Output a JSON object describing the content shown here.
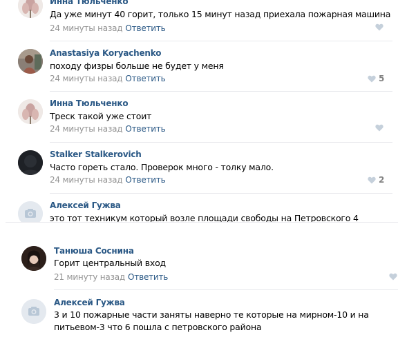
{
  "comments_top": [
    {
      "author": "Инна Тюльченко",
      "text": "Да уже минут 40 горит, только 15 минут назад приехала пожарная машина",
      "time": "24 минуты назад",
      "reply_label": "Ответить",
      "likes": ""
    },
    {
      "author": "Anastasiya Koryachenko",
      "text": "походу физры больше не будет у меня",
      "time": "24 минуты назад",
      "reply_label": "Ответить",
      "likes": "5"
    },
    {
      "author": "Инна Тюльченко",
      "text": "Треск такой уже стоит",
      "time": "24 минуты назад",
      "reply_label": "Ответить",
      "likes": ""
    },
    {
      "author": "Stalker Stalkerovich",
      "text": "Часто гореть стало. Проверок много - толку мало.",
      "time": "24 минуты назад",
      "reply_label": "Ответить",
      "likes": "2"
    },
    {
      "author": "Алексей Гужва",
      "text": "это тот техникум который возле площади свободы на Петровского 4"
    }
  ],
  "comments_bottom": [
    {
      "author": "Танюша Соснина",
      "text": "Горит центральный вход",
      "time": "21 минуту назад",
      "reply_label": "Ответить",
      "likes": ""
    },
    {
      "author": "Алексей Гужва",
      "text_line1": "3 и 10 пожарные части заняты наверно те которые на мирном-10 и на",
      "text_line2": "питьевом-3 что 6 пошла с петровского района"
    }
  ],
  "colors": {
    "link": "#2a5885",
    "meta": "#939393",
    "divider": "#e7e8ec",
    "like_icon": "#c5d0db"
  }
}
